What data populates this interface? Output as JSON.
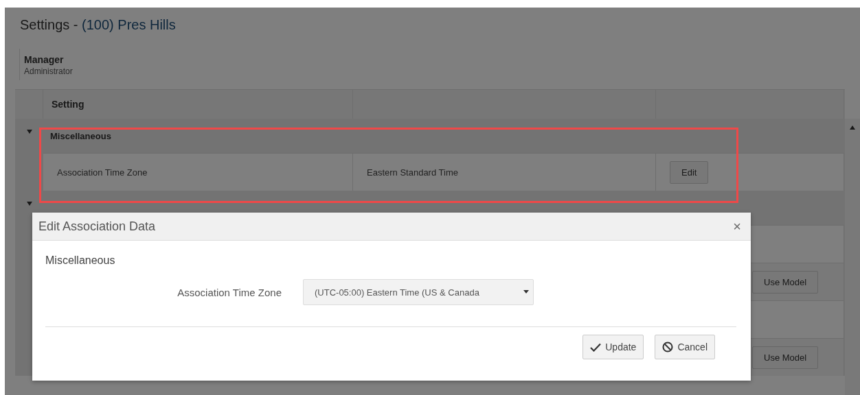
{
  "page": {
    "title": "Settings - ",
    "title_link": "(100) Pres Hills"
  },
  "user": {
    "name": "Manager",
    "role": "Administrator"
  },
  "table": {
    "columns": [
      "Setting"
    ],
    "rows": [
      {
        "kind": "group",
        "expanded": true,
        "name": "Miscellaneous",
        "highlighted": true
      },
      {
        "kind": "setting",
        "name": "Association Time Zone",
        "value": "Eastern Standard Time",
        "actions": [
          {
            "kind": "edit",
            "label": "Edit"
          }
        ],
        "highlighted": true
      },
      {
        "kind": "group",
        "expanded": true
      },
      {
        "kind": "setting",
        "actions": []
      },
      {
        "kind": "setting",
        "actions": [
          {
            "kind": "use_model",
            "label": "Use Model"
          }
        ]
      },
      {
        "kind": "setting",
        "actions": []
      },
      {
        "kind": "setting",
        "actions": [
          {
            "kind": "use_model",
            "label": "Use Model"
          }
        ]
      }
    ]
  },
  "dialog": {
    "title": "Edit Association Data",
    "close": "×",
    "section": "Miscellaneous",
    "fields": [
      {
        "label": "Association Time Zone",
        "value": "(UTC-05:00) Eastern Time (US & Canada"
      }
    ],
    "buttons": [
      {
        "kind": "update",
        "label": "Update"
      },
      {
        "kind": "cancel",
        "label": "Cancel"
      }
    ]
  }
}
